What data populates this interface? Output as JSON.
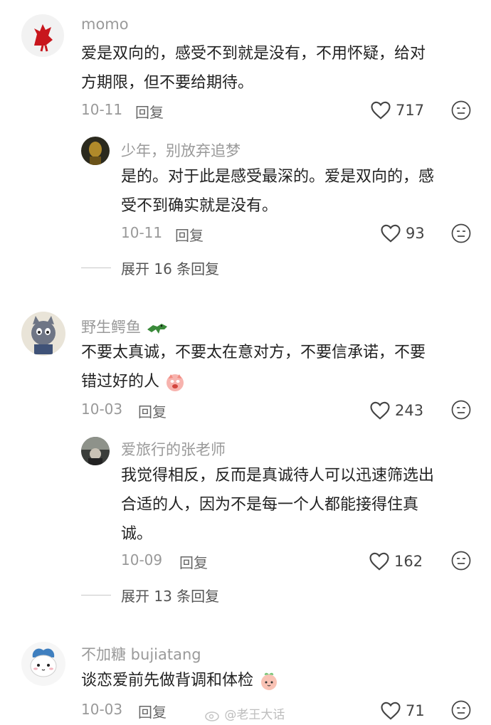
{
  "comments": [
    {
      "user": "momo",
      "text_line1": "爱是双向的，感受不到就是没有，不用怀疑，给对",
      "text_line2": "方期限，但不要给期待。",
      "date": "10-11",
      "reply_label": "回复",
      "likes": "717",
      "replies": [
        {
          "user": "少年，别放弃追梦",
          "text_line1": "是的。对于此是感受最深的。爱是双向的，感",
          "text_line2": "受不到确实就是没有。",
          "date": "10-11",
          "reply_label": "回复",
          "likes": "93"
        }
      ],
      "expand_label": "展开 16 条回复"
    },
    {
      "user": "野生鳄鱼",
      "text_line1": "不要太真诚，不要太在意对方，不要信承诺，不要",
      "text_line2": "错过好的人",
      "date": "10-03",
      "reply_label": "回复",
      "likes": "243",
      "replies": [
        {
          "user": "爱旅行的张老师",
          "text_line1": "我觉得相反，反而是真诚待人可以迅速筛选出",
          "text_line2": "合适的人，因为不是每一个人都能接得住真",
          "text_line3": "诚。",
          "date": "10-09",
          "reply_label": "回复",
          "likes": "162"
        }
      ],
      "expand_label": "展开 13 条回复"
    },
    {
      "user": "不加糖 bujiatang",
      "text_line1": "谈恋爱前先做背调和体检",
      "date": "10-03",
      "reply_label": "回复",
      "likes": "71"
    }
  ],
  "watermark": "@老王大话"
}
